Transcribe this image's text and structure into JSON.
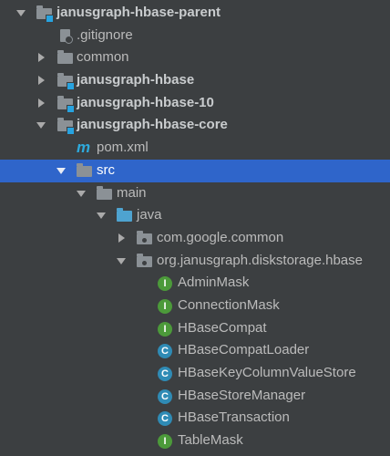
{
  "tree": {
    "root": {
      "label": "janusgraph-hbase-parent",
      "icon": "module-folder-icon"
    },
    "items": [
      {
        "label": ".gitignore",
        "icon": "gitignore-file-icon"
      },
      {
        "label": "common",
        "icon": "folder-icon"
      },
      {
        "label": "janusgraph-hbase",
        "icon": "module-folder-icon"
      },
      {
        "label": "janusgraph-hbase-10",
        "icon": "module-folder-icon"
      },
      {
        "label": "janusgraph-hbase-core",
        "icon": "module-folder-icon"
      },
      {
        "label": "pom.xml",
        "icon": "maven-icon",
        "glyph": "m"
      },
      {
        "label": "src",
        "icon": "folder-icon"
      },
      {
        "label": "main",
        "icon": "folder-icon"
      },
      {
        "label": "java",
        "icon": "source-folder-icon"
      },
      {
        "label": "com.google.common",
        "icon": "package-icon"
      },
      {
        "label": "org.janusgraph.diskstorage.hbase",
        "icon": "package-icon"
      },
      {
        "label": "AdminMask",
        "icon": "interface-icon",
        "glyph": "I"
      },
      {
        "label": "ConnectionMask",
        "icon": "interface-icon",
        "glyph": "I"
      },
      {
        "label": "HBaseCompat",
        "icon": "interface-icon",
        "glyph": "I"
      },
      {
        "label": "HBaseCompatLoader",
        "icon": "class-icon",
        "glyph": "C"
      },
      {
        "label": "HBaseKeyColumnValueStore",
        "icon": "class-icon",
        "glyph": "C"
      },
      {
        "label": "HBaseStoreManager",
        "icon": "class-icon",
        "glyph": "C"
      },
      {
        "label": "HBaseTransaction",
        "icon": "class-icon",
        "glyph": "C"
      },
      {
        "label": "TableMask",
        "icon": "interface-icon",
        "glyph": "I"
      }
    ],
    "selected": "src"
  },
  "colors": {
    "background": "#3c3f41",
    "selection": "#2f65ca",
    "interface": "#4c9a3a",
    "class": "#2f8bb5",
    "module-badge": "#27a3e0"
  }
}
